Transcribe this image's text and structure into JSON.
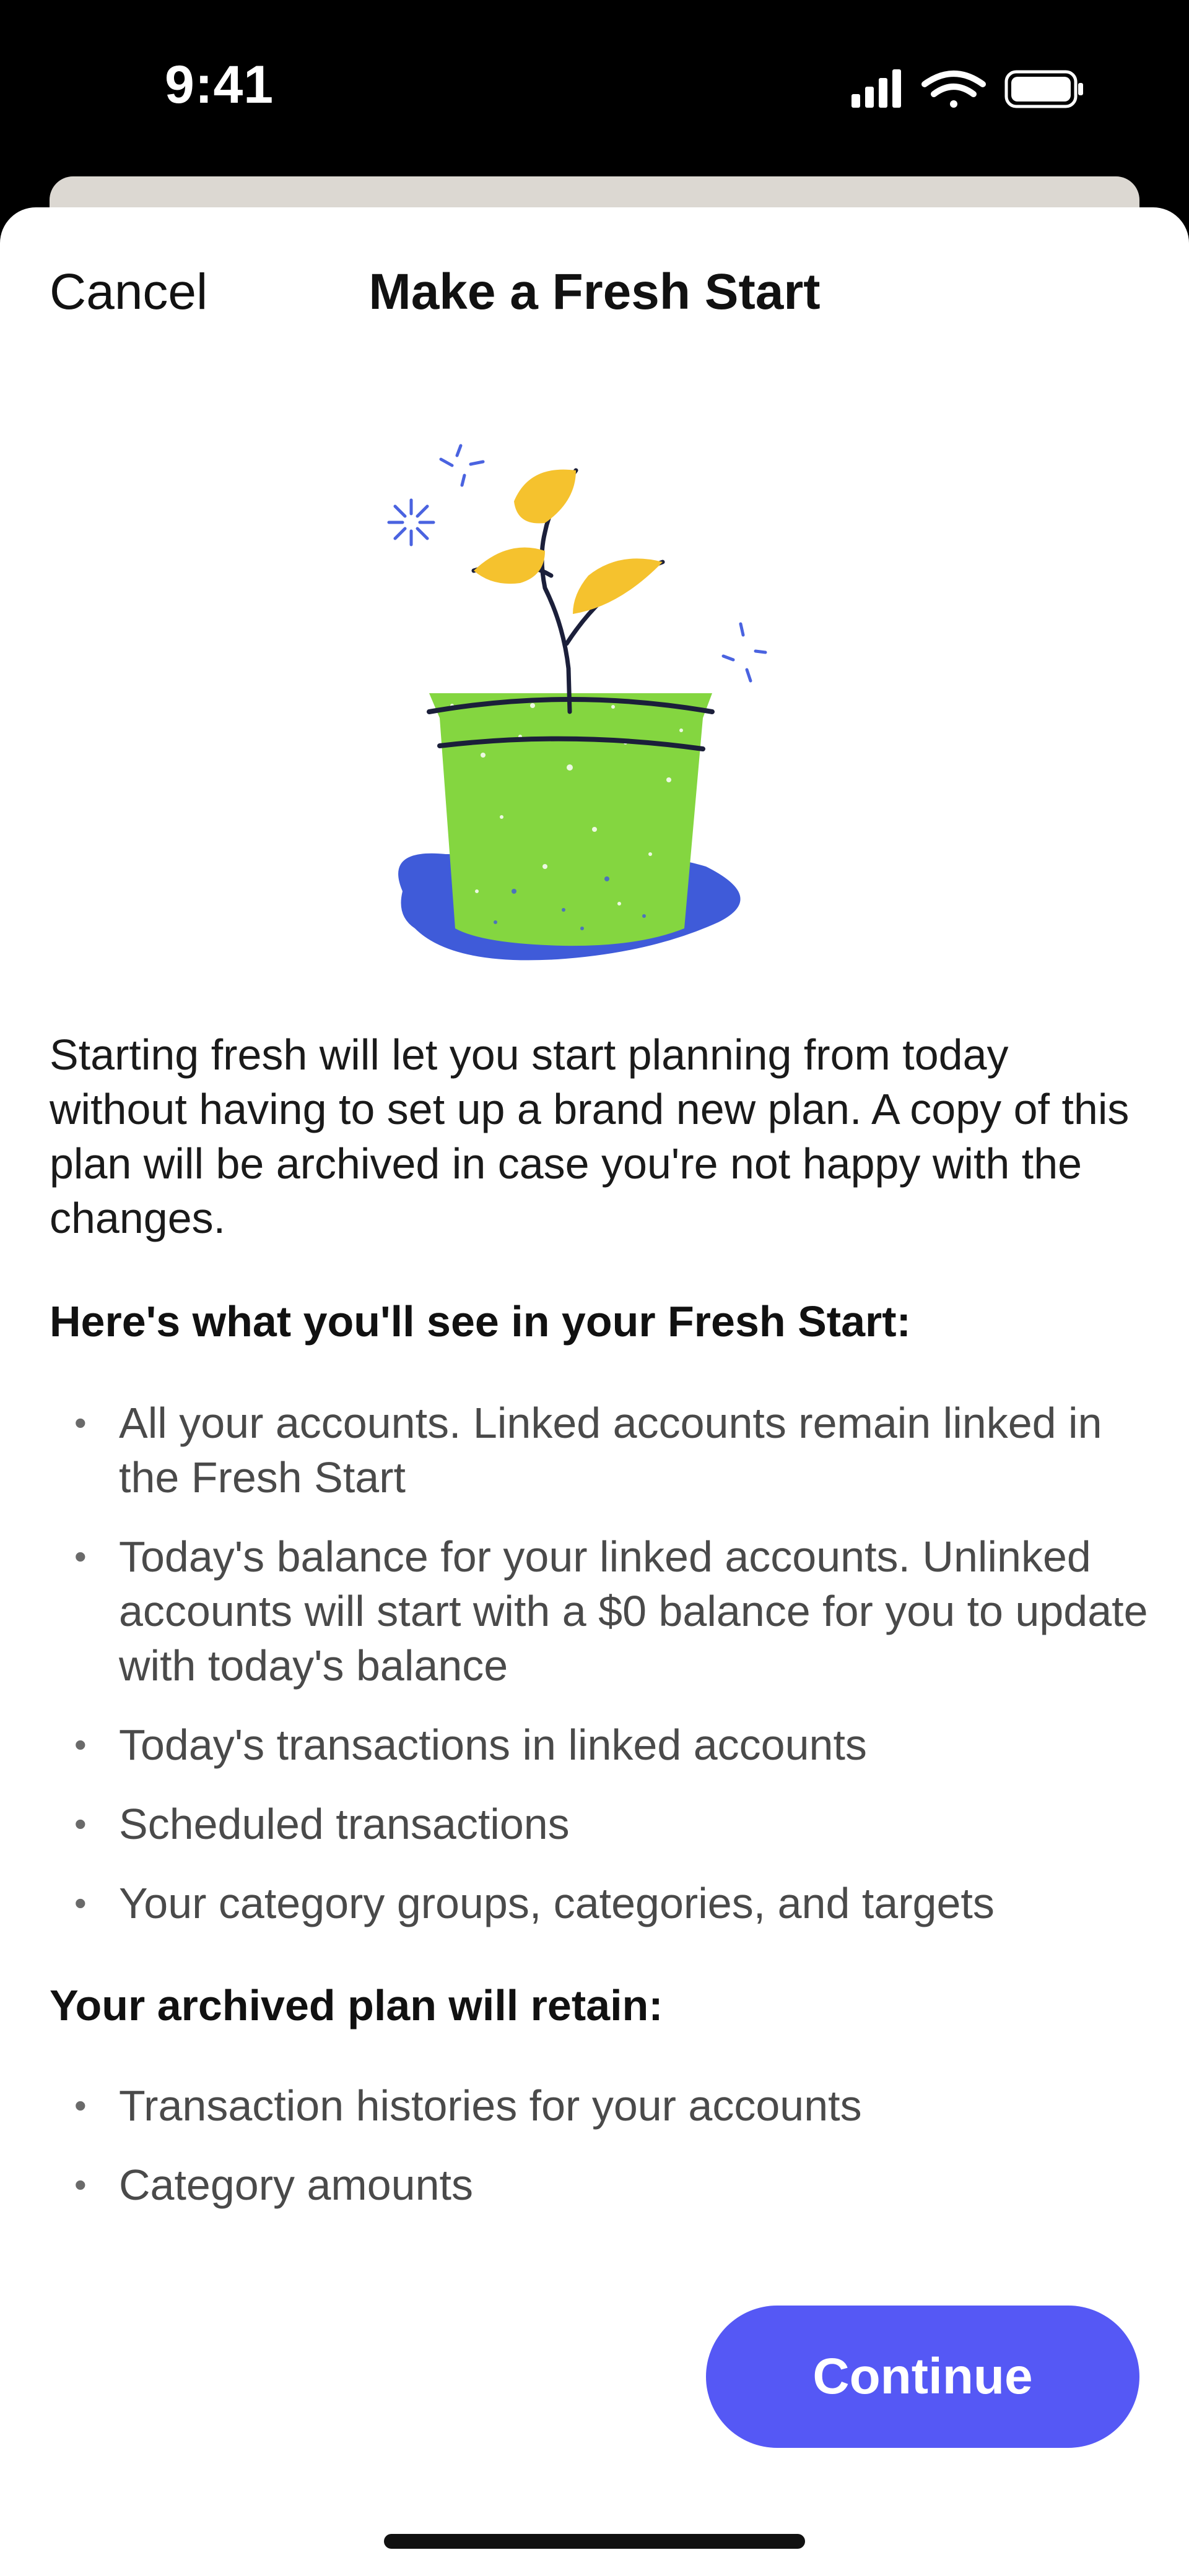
{
  "status_bar": {
    "time": "9:41",
    "icons": [
      "cellular-signal-icon",
      "wifi-icon",
      "battery-icon"
    ]
  },
  "nav": {
    "cancel_label": "Cancel",
    "title": "Make a Fresh Start"
  },
  "hero": {
    "icon": "plant-in-pot-illustration",
    "colors": {
      "pot": "#84d640",
      "leaves": "#f5c22e",
      "puddle": "#3f5bd9",
      "stroke": "#1b1f3a",
      "sparkle": "#4a63e0"
    }
  },
  "content": {
    "intro": "Starting fresh will let you start planning from today without having to set up a brand new plan. A copy of this plan will be archived in case you're not happy with the changes.",
    "fresh_start_heading": "Here's what you'll see in your Fresh Start:",
    "fresh_start_items": [
      "All your accounts. Linked accounts remain linked in the Fresh Start",
      "Today's balance for your linked accounts. Unlinked accounts will start with a $0 balance for you to update with today's balance",
      "Today's transactions in linked accounts",
      "Scheduled transactions",
      "Your category groups, categories, and targets"
    ],
    "archived_heading": "Your archived plan will retain:",
    "archived_items": [
      "Transaction histories for your accounts",
      "Category amounts"
    ]
  },
  "footer": {
    "continue_label": "Continue",
    "accent_color": "#5558f5"
  }
}
